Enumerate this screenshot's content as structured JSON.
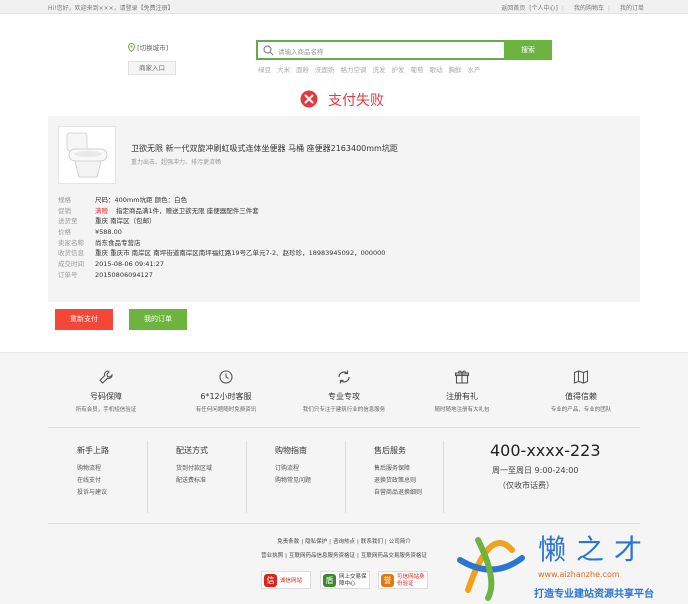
{
  "topbar": {
    "greeting": "Hi!您好，欢迎来到×××，请登录",
    "register": "【免费注册】",
    "links": [
      "返回首页",
      "[个人中心]",
      "我的购物车",
      "我的订单"
    ]
  },
  "header": {
    "city": "[切换城市]",
    "merchant_entry": "商家入口",
    "search_placeholder": "请输入商品名称",
    "search_button": "搜索",
    "hot_words": [
      "绿豆",
      "大米",
      "面粉",
      "洗面奶",
      "格力空调",
      "洗发",
      "护发",
      "葡萄",
      "眼动",
      "胸鲜",
      "水产"
    ]
  },
  "status": {
    "title": "支付失败",
    "color": "#e4393c"
  },
  "product": {
    "title": "卫欲无限 新一代双旋冲刷虹吸式连体坐便器 马桶 座便器2163400mm坑距",
    "subtitle": "重力出击、超强冲力、排污更流畅"
  },
  "details": [
    {
      "key": "规格",
      "value": "尺码：400mm坑距 颜色：白色"
    },
    {
      "key": "促销",
      "tag": "满赠",
      "value": "指定商品满1件，赠送卫欲无限 座便器配件三件套"
    },
    {
      "key": "送货至",
      "value": "重庆 南岸区（包邮）"
    },
    {
      "key": "价格",
      "value": "¥588.00"
    },
    {
      "key": "卖家名称",
      "value": "尚东食品专营店"
    },
    {
      "key": "收货信息",
      "value": "重庆 重庆市 南岸区 南坪街道南岸区南坪福红路19号乙单元7-2、赵珍珍，18983945092，000000"
    },
    {
      "key": "成交时间",
      "value": "2015-08-06 09:41:27"
    },
    {
      "key": "订单号",
      "value": "20150806094127"
    }
  ],
  "actions": {
    "retry": "重新支付",
    "my_orders": "我的订单"
  },
  "services": [
    {
      "title": "号码保障",
      "desc": "所有会员，手机短信验证",
      "icon": "wrench-icon"
    },
    {
      "title": "6*12小时客服",
      "desc": "有任何问题随时免费资讯",
      "icon": "clock-icon"
    },
    {
      "title": "专业专攻",
      "desc": "我们只专注于建筑行业的信息服务",
      "icon": "refresh-icon"
    },
    {
      "title": "注册有礼",
      "desc": "随时随地注册有大礼包",
      "icon": "gift-icon"
    },
    {
      "title": "值得信赖",
      "desc": "专业的产品、专业的团队",
      "icon": "map-icon"
    }
  ],
  "footer_columns": [
    {
      "title": "新手上路",
      "items": [
        "购物流程",
        "在线支付",
        "投诉与建议"
      ]
    },
    {
      "title": "配送方式",
      "items": [
        "货到付款区域",
        "配送费标准"
      ]
    },
    {
      "title": "购物指南",
      "items": [
        "订购流程",
        "购物常见问题"
      ]
    },
    {
      "title": "售后服务",
      "items": [
        "售后服务保障",
        "退换货政策总则",
        "自营商品退换细则"
      ]
    }
  ],
  "contact": {
    "phone": "400-xxxx-223",
    "hours": "周一至周日 9:00-24:00",
    "note": "（仅收市话费）"
  },
  "footer_links": [
    "免责条款",
    "隐私保护",
    "咨询热点",
    "联系我们",
    "公司简介"
  ],
  "footer_licenses": [
    "营业执照",
    "互联网药品信息服务资格证",
    "互联网药品交易服务资格证"
  ],
  "badges": [
    {
      "icon": "信",
      "label": "诚信网站",
      "color": "#d9261c"
    },
    {
      "icon": "盾",
      "label": "网上交易保障中心",
      "color": "#3a8a2c"
    },
    {
      "icon": "誉",
      "label": "可信网站身份验证",
      "color": "#e07b12"
    }
  ],
  "watermark": {
    "text": "懒之才",
    "url": "www.aizhanzhe.com",
    "slogan": "打造专业建站资源共享平台"
  }
}
